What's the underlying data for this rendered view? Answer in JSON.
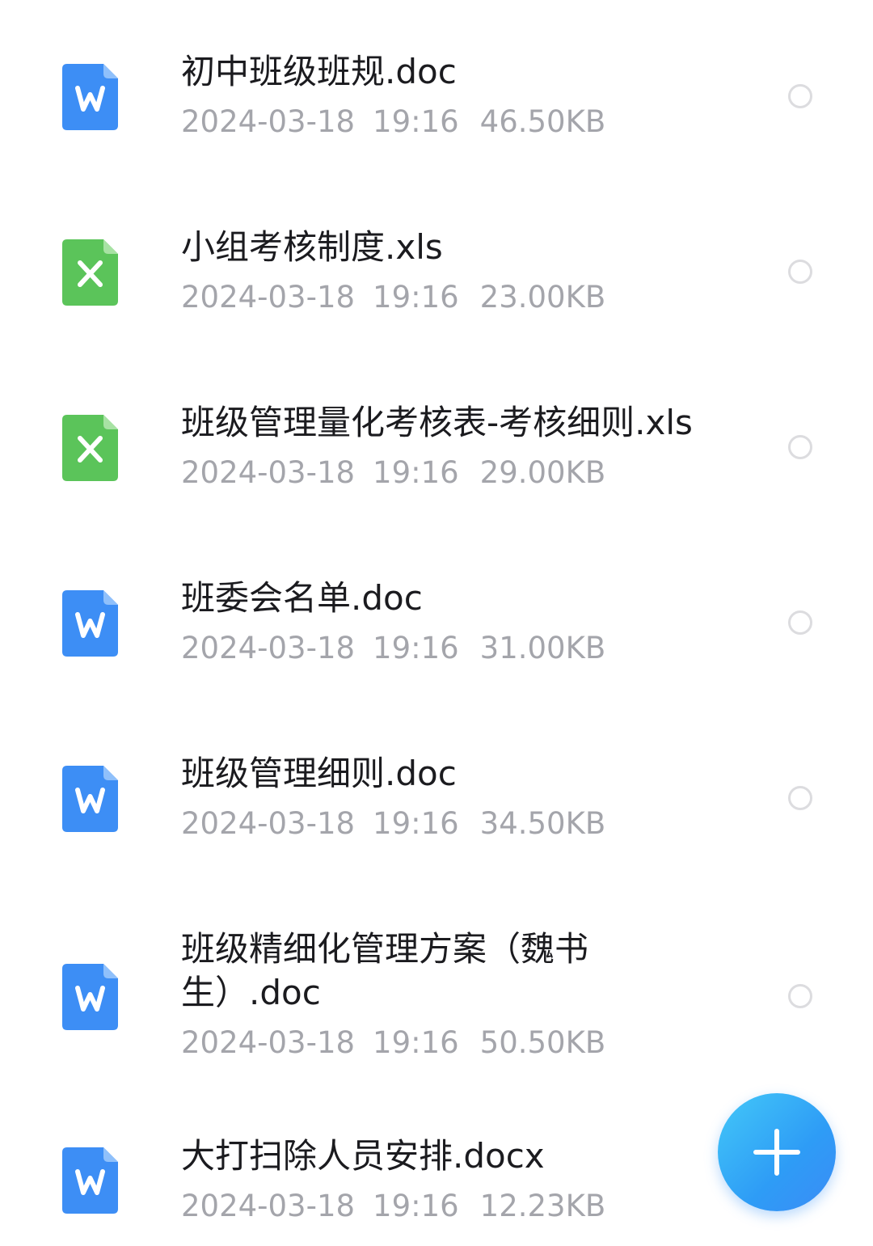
{
  "files": [
    {
      "name": "初中班级班规.doc",
      "date": "2024-03-18",
      "time": "19:16",
      "size": "46.50KB",
      "type_icon": "word-doc-icon"
    },
    {
      "name": "小组考核制度.xls",
      "date": "2024-03-18",
      "time": "19:16",
      "size": "23.00KB",
      "type_icon": "excel-xls-icon"
    },
    {
      "name": "班级管理量化考核表-考核细则.xls",
      "date": "2024-03-18",
      "time": "19:16",
      "size": "29.00KB",
      "type_icon": "excel-xls-icon"
    },
    {
      "name": "班委会名单.doc",
      "date": "2024-03-18",
      "time": "19:16",
      "size": "31.00KB",
      "type_icon": "word-doc-icon"
    },
    {
      "name": "班级管理细则.doc",
      "date": "2024-03-18",
      "time": "19:16",
      "size": "34.50KB",
      "type_icon": "word-doc-icon"
    },
    {
      "name": "班级精细化管理方案（魏书生）.doc",
      "date": "2024-03-18",
      "time": "19:16",
      "size": "50.50KB",
      "type_icon": "word-doc-icon"
    },
    {
      "name": "大打扫除人员安排.docx",
      "date": "2024-03-18",
      "time": "19:16",
      "size": "12.23KB",
      "type_icon": "word-doc-icon"
    }
  ],
  "fab": {
    "icon": "plus-icon"
  },
  "colors": {
    "word_blue": "#3d8ef5",
    "excel_green": "#5bc45a",
    "fab_blue": "#2e9cf6",
    "meta_gray": "#a4a5ab"
  }
}
